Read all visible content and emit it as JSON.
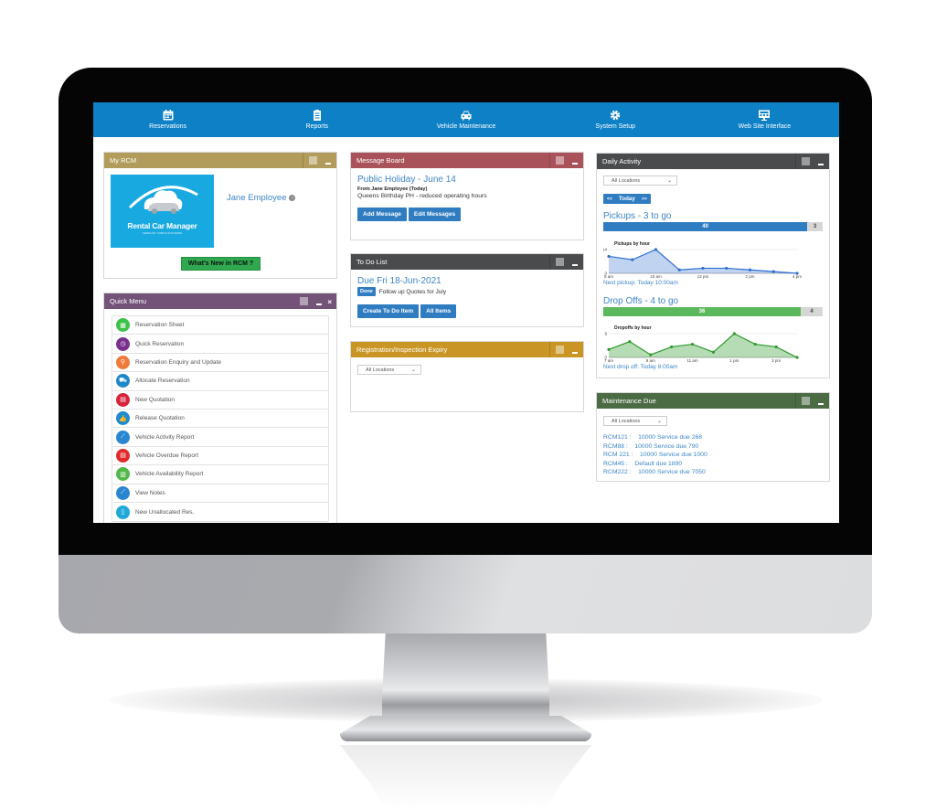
{
  "nav": [
    {
      "label": "Reservations",
      "icon": "calendar-icon"
    },
    {
      "label": "Reports",
      "icon": "clipboard-icon"
    },
    {
      "label": "Vehicle Maintenance",
      "icon": "car-icon"
    },
    {
      "label": "System Setup",
      "icon": "gear-icon"
    },
    {
      "label": "Web Site Interface",
      "icon": "monitor-icon"
    }
  ],
  "my_rcm": {
    "title": "My RCM",
    "logo_text": "Rental Car Manager",
    "logo_tagline": "SERIOUSLY SIMPLE SOFTWARE",
    "user_name": "Jane Employee",
    "whats_new_label": "What's New in RCM ?"
  },
  "quick_menu": {
    "title": "Quick Menu",
    "items": [
      {
        "label": "Reservation Sheet",
        "icon": "calendar-icon",
        "color": "#3cc24a"
      },
      {
        "label": "Quick Reservation",
        "icon": "tablet-clock-icon",
        "color": "#7a2f8f"
      },
      {
        "label": "Reservation Enquiry and Update",
        "icon": "search-icon",
        "color": "#f07a3a"
      },
      {
        "label": "Allocate Reservation",
        "icon": "car-icon",
        "color": "#1e88c8"
      },
      {
        "label": "New Quotation",
        "icon": "document-icon",
        "color": "#d8243a"
      },
      {
        "label": "Release Quotation",
        "icon": "thumbs-up-icon",
        "color": "#1e8ad0"
      },
      {
        "label": "Vehicle Activity Report",
        "icon": "chart-icon",
        "color": "#2a86cf"
      },
      {
        "label": "Vehicle Overdue Report",
        "icon": "document-icon",
        "color": "#e02a2a"
      },
      {
        "label": "Vehicle Availability Report",
        "icon": "bar-chart-icon",
        "color": "#52b848"
      },
      {
        "label": "View Notes",
        "icon": "chart-icon",
        "color": "#2a86cf"
      },
      {
        "label": "New Unallocated Res.",
        "icon": "book-icon",
        "color": "#1fa8d8"
      }
    ]
  },
  "message_board": {
    "title": "Message Board",
    "message_title": "Public Holiday - June 14",
    "from": "From Jane Employee (Today)",
    "body": "Queens Birthday PH - reduced operating hours",
    "add_label": "Add Message",
    "edit_label": "Edit Messages"
  },
  "todo": {
    "title": "To Do List",
    "due": "Due Fri 18-Jun-2021",
    "done_label": "Done",
    "item": "Follow up Quotes for July",
    "create_label": "Create To Do Item",
    "all_label": "All Items"
  },
  "registration": {
    "title": "Registration/Inspection Expiry",
    "location": "All Locations"
  },
  "daily_activity": {
    "title": "Daily Activity",
    "location": "All Locations",
    "prev_label": "<<",
    "today_label": "Today",
    "next_label": ">>",
    "pickups_title": "Pickups - 3 to go",
    "pickups_done": 40,
    "pickups_remaining": 3,
    "next_pickup": "Next pickup: Today 10:00am",
    "dropoffs_title": "Drop Offs - 4 to go",
    "dropoffs_done": 36,
    "dropoffs_remaining": 4,
    "next_dropoff": "Next drop off: Today 8:00am",
    "colors": {
      "pickups": "#2f6fd0",
      "dropoffs": "#2e9a2e",
      "pickup_bar": "#2f7cc1",
      "dropoff_bar": "#5cb85c"
    }
  },
  "chart_data": [
    {
      "type": "area",
      "title": "Pickups by hour",
      "x": [
        "8 am",
        "9 am",
        "10 am",
        "11 am",
        "12 pm",
        "1 pm",
        "2 pm",
        "3 pm",
        "4 pm"
      ],
      "values": [
        10,
        8,
        14,
        2,
        3,
        3,
        2,
        1,
        0
      ],
      "tick_labels": [
        "8 am",
        "10 am",
        "12 pm",
        "2 pm",
        "4 pm"
      ],
      "ylim": [
        0,
        14
      ],
      "yticks": [
        0,
        14
      ]
    },
    {
      "type": "area",
      "title": "Dropoffs by hour",
      "x": [
        "7 am",
        "8 am",
        "9 am",
        "10 am",
        "11 am",
        "12 pm",
        "1 pm",
        "2 pm",
        "3 pm",
        "4 pm"
      ],
      "values": [
        3,
        6,
        1,
        4,
        5,
        2,
        9,
        5,
        4,
        0
      ],
      "tick_labels": [
        "7 am",
        "9 am",
        "11 am",
        "1 pm",
        "3 pm"
      ],
      "ylim": [
        0,
        9
      ],
      "yticks": [
        0,
        9
      ]
    }
  ],
  "maintenance": {
    "title": "Maintenance Due",
    "location": "All Locations",
    "rows": [
      "RCM121 :    10000 Service due 268",
      "RCM88 :    10000 Service due 790",
      "RCM 221 :    10000 Service due 1000",
      "RCM45 :    Default due 1890",
      "RCM222 :    10000 Service due 7050"
    ]
  }
}
